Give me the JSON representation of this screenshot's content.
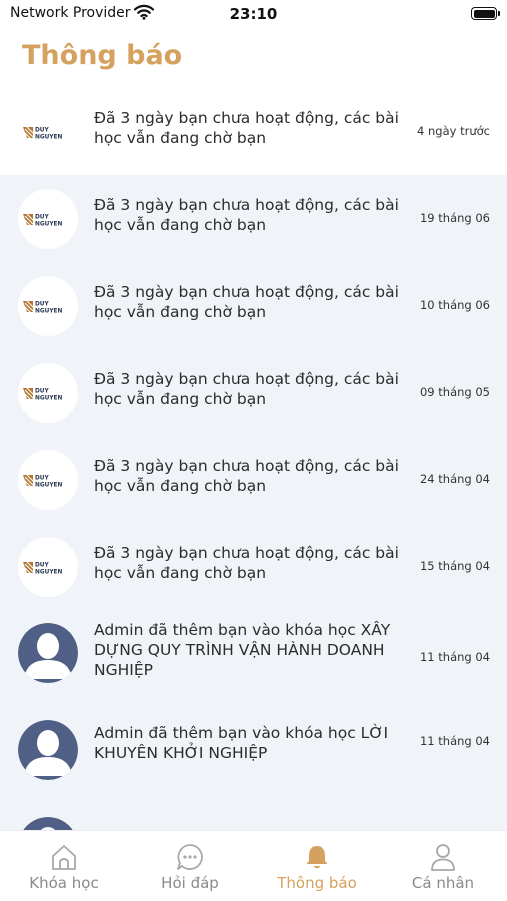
{
  "status_bar": {
    "carrier": "Network Provider",
    "time": "23:10"
  },
  "page": {
    "title": "Thông báo"
  },
  "notifications": [
    {
      "text": "Đã 3 ngày bạn chưa hoạt động, các bài học vẫn đang chờ bạn",
      "date": "4 ngày trước",
      "avatar": "duy-nguyen-logo"
    },
    {
      "text": "Đã 3 ngày bạn chưa hoạt động, các bài học vẫn đang chờ bạn",
      "date": "19 tháng 06",
      "avatar": "duy-nguyen-logo"
    },
    {
      "text": "Đã 3 ngày bạn chưa hoạt động, các bài học vẫn đang chờ bạn",
      "date": "10 tháng 06",
      "avatar": "duy-nguyen-logo"
    },
    {
      "text": "Đã 3 ngày bạn chưa hoạt động, các bài học vẫn đang chờ bạn",
      "date": "09 tháng 05",
      "avatar": "duy-nguyen-logo"
    },
    {
      "text": "Đã 3 ngày bạn chưa hoạt động, các bài học vẫn đang chờ bạn",
      "date": "24 tháng 04",
      "avatar": "duy-nguyen-logo"
    },
    {
      "text": "Đã 3 ngày bạn chưa hoạt động, các bài học vẫn đang chờ bạn",
      "date": "15 tháng 04",
      "avatar": "duy-nguyen-logo"
    },
    {
      "text": "Admin đã thêm bạn vào khóa học XÂY DỰNG QUY TRÌNH VẬN HÀNH DOANH NGHIỆP",
      "date": "11 tháng 04",
      "avatar": "user-placeholder"
    },
    {
      "text": "Admin đã thêm bạn vào khóa học LỜI KHUYÊN KHỞI NGHIỆP",
      "date": "11 tháng 04",
      "avatar": "user-placeholder"
    }
  ],
  "logo": {
    "line1": "DUY",
    "line2": "NGUYEN"
  },
  "tabs": [
    {
      "label": "Khóa học",
      "icon": "home-icon",
      "active": false
    },
    {
      "label": "Hỏi đáp",
      "icon": "chat-bubble-icon",
      "active": false
    },
    {
      "label": "Thông báo",
      "icon": "bell-icon",
      "active": true
    },
    {
      "label": "Cá nhân",
      "icon": "user-icon",
      "active": false
    }
  ],
  "colors": {
    "accent": "#d4a15e",
    "list_bg": "#f0f3f8",
    "avatar_bg": "#4f5f85",
    "tab_inactive": "#8a8a8a"
  }
}
